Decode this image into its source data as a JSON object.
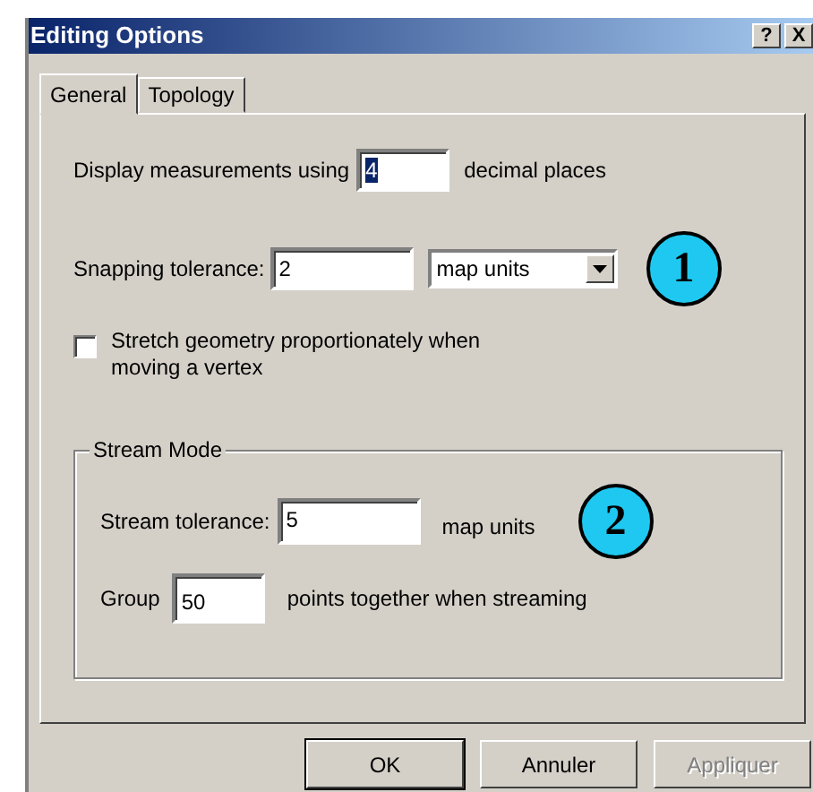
{
  "window": {
    "title": "Editing Options",
    "title_buttons": [
      "?",
      "X"
    ]
  },
  "tabs": [
    {
      "label": "General",
      "selected": true
    },
    {
      "label": "Topology",
      "selected": false
    }
  ],
  "decimal_places": {
    "label": "Display measurements using",
    "value": "4",
    "value_selected": true,
    "suffix": "decimal places"
  },
  "snapping": {
    "label": "Snapping tolerance:",
    "value": "2",
    "units": "map units",
    "callout": "1"
  },
  "stretch": {
    "label": "Stretch geometry proportionately when moving a vertex",
    "checked": false
  },
  "stream_mode": {
    "title": "Stream Mode",
    "tolerance_label": "Stream tolerance:",
    "tolerance_value": "5",
    "units": "map units",
    "callout": "2",
    "group_label": "Group",
    "group_value": "50",
    "group_suffix": "points together when streaming"
  },
  "buttons": [
    {
      "label": "OK",
      "default": true,
      "disabled": false
    },
    {
      "label": "Annuler",
      "default": false,
      "disabled": false
    },
    {
      "label": "Appliquer",
      "default": false,
      "disabled": true
    }
  ]
}
